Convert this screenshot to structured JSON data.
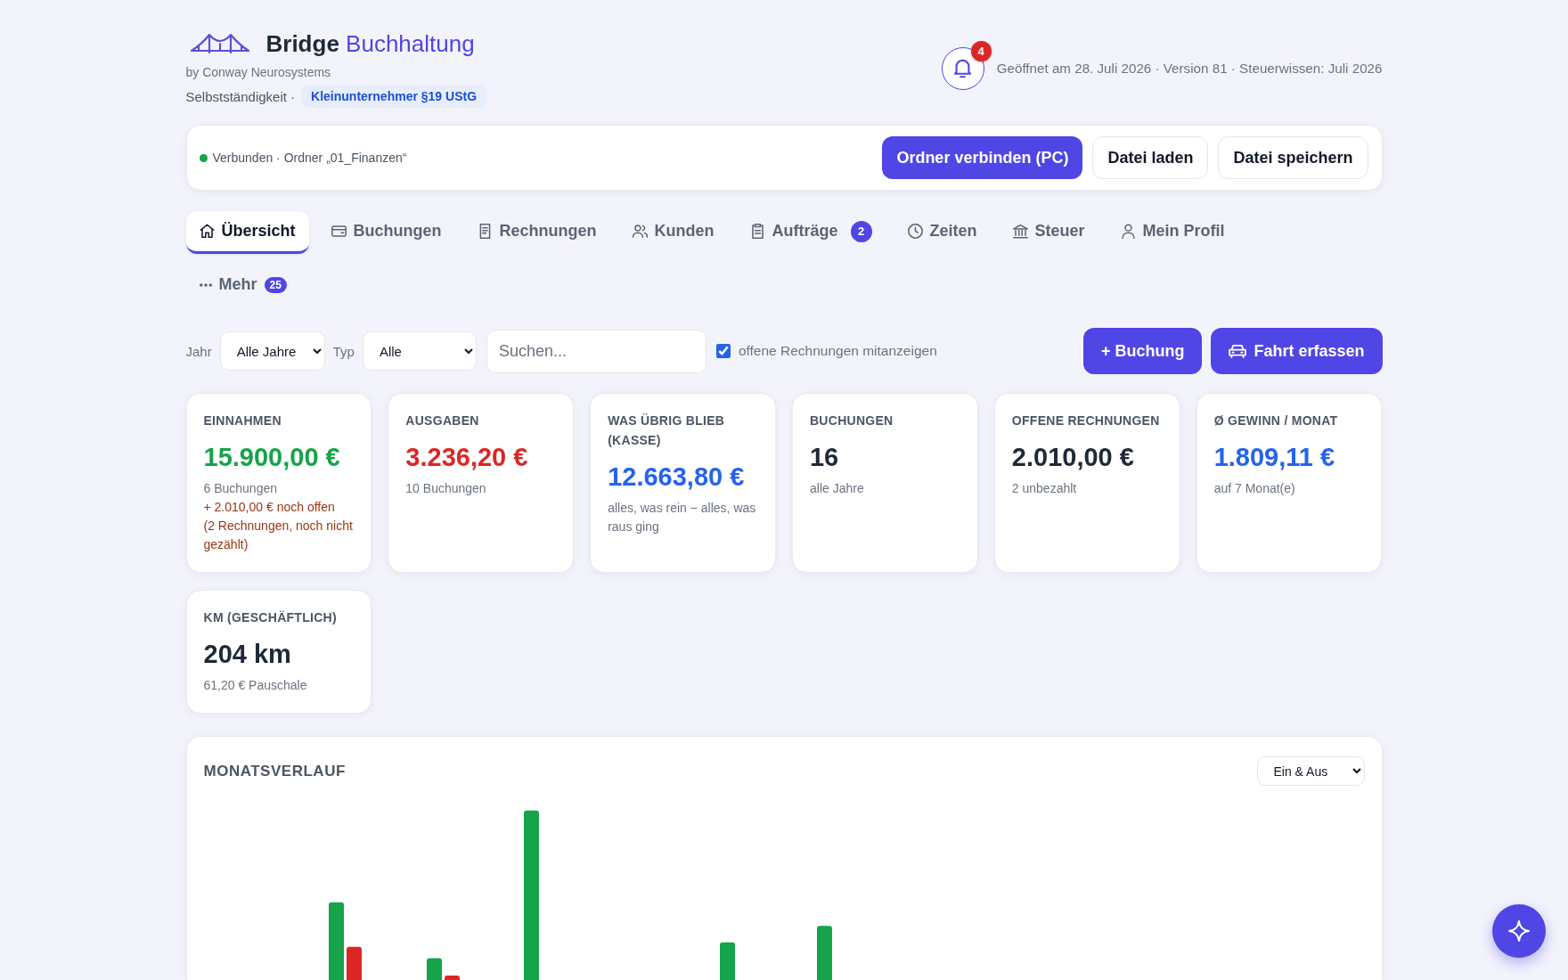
{
  "brand": {
    "name": "Bridge",
    "name_accent": "Buchhaltung",
    "byline": "by Conway Neurosystems",
    "mode": "Selbstständigkeit ·",
    "badge": "Kleinunternehmer §19 UStG"
  },
  "header": {
    "notification_count": "4",
    "meta": "Geöffnet am 28. Juli 2026 · Version 81 · Steuerwissen: Juli 2026"
  },
  "storage": {
    "connected": true,
    "status": "Verbunden · Ordner „01_Finanzen“",
    "buttons": [
      {
        "label": "Ordner verbinden (PC)",
        "kind": "primary"
      },
      {
        "label": "Datei laden",
        "kind": "secondary"
      },
      {
        "label": "Datei speichern",
        "kind": "secondary"
      }
    ]
  },
  "tabs": [
    {
      "label": "Übersicht",
      "selected": true
    },
    {
      "label": "Buchungen",
      "selected": false
    },
    {
      "label": "Rechnungen",
      "selected": false
    },
    {
      "label": "Kunden",
      "selected": false
    },
    {
      "label": "Aufträge",
      "selected": false,
      "badge": "2"
    },
    {
      "label": "Zeiten",
      "selected": false
    },
    {
      "label": "Steuer",
      "selected": false
    },
    {
      "label": "Mein Profil",
      "selected": false
    },
    {
      "label": "Mehr",
      "selected": false,
      "badge": "25"
    }
  ],
  "filters": {
    "year_label": "Jahr",
    "year": "Alle Jahre",
    "type_label": "Typ",
    "type": "Alle",
    "search": {
      "placeholder": "Suchen..."
    },
    "show_open_invoices": {
      "label": "offene Rechnungen mitanzeigen",
      "checked": true
    },
    "new_entry_button": "+ Buchung",
    "trip_button": "Fahrt erfassen"
  },
  "stats": [
    {
      "label": "EINNAHMEN",
      "value": "15.900,00 €",
      "color": "#16a34a",
      "notes": [
        {
          "text": "6 Buchungen",
          "kind": "muted"
        },
        {
          "text": "+ 2.010,00 € noch offen",
          "kind": "warning"
        },
        {
          "text": "(2 Rechnungen, noch nicht gezählt)",
          "kind": "warning"
        }
      ]
    },
    {
      "label": "AUSGABEN",
      "value": "3.236,20 €",
      "color": "#dc2626",
      "notes": [
        {
          "text": "10 Buchungen",
          "kind": "muted"
        }
      ]
    },
    {
      "label": "WAS ÜBRIG BLIEB (KASSE)",
      "value": "12.663,80 €",
      "color": "#2563eb",
      "notes": [
        {
          "text": "alles, was rein − alles, was raus ging",
          "kind": "muted"
        }
      ]
    },
    {
      "label": "BUCHUNGEN",
      "value": "16",
      "color": "#1f2937",
      "notes": [
        {
          "text": "alle Jahre",
          "kind": "muted"
        }
      ]
    },
    {
      "label": "OFFENE RECHNUNGEN",
      "value": "2.010,00 €",
      "color": "#1f2937",
      "notes": [
        {
          "text": "2 unbezahlt",
          "kind": "muted"
        }
      ]
    },
    {
      "label": "Ø GEWINN / MONAT",
      "value": "1.809,11 €",
      "color": "#2563eb",
      "notes": [
        {
          "text": "auf 7 Monat(e)",
          "kind": "muted"
        }
      ]
    },
    {
      "label": "KM (GESCHÄFTLICH)",
      "value": "204 km",
      "color": "#1f2937",
      "notes": [
        {
          "text": "61,20 € Pauschale",
          "kind": "muted"
        }
      ]
    }
  ],
  "chart_panel": {
    "title": "MONATSVERLAUF",
    "view": "Ein & Aus"
  }
}
